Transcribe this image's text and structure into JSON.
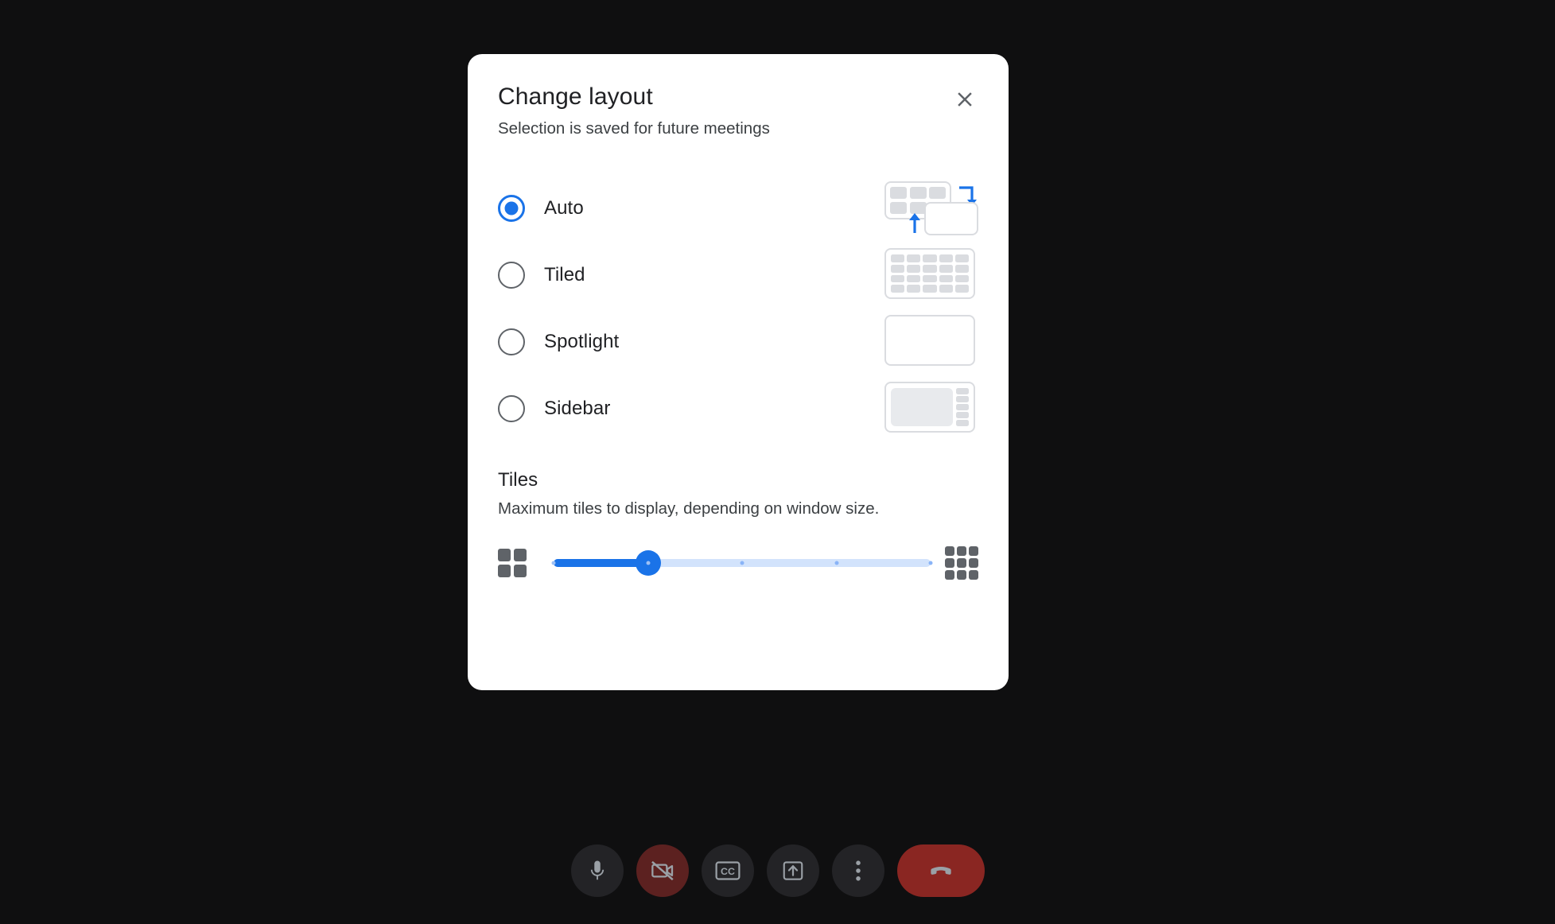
{
  "background_color": "#0f0f10",
  "dialog": {
    "title": "Change layout",
    "subtitle": "Selection is saved for future meetings",
    "close_label": "Close",
    "close_icon": "close-icon",
    "accent_color": "#1a73e8",
    "options": [
      {
        "id": "auto",
        "label": "Auto",
        "selected": true,
        "preview": "auto-preview-grid-and-pip"
      },
      {
        "id": "tiled",
        "label": "Tiled",
        "selected": false,
        "preview": "tiled-preview-5x4-grid"
      },
      {
        "id": "spotlight",
        "label": "Spotlight",
        "selected": false,
        "preview": "spotlight-preview-single-tile"
      },
      {
        "id": "sidebar",
        "label": "Sidebar",
        "selected": false,
        "preview": "sidebar-preview-main-plus-rail"
      }
    ],
    "tiles": {
      "title": "Tiles",
      "description": "Maximum tiles to display, depending on window size.",
      "min_icon": "grid-2x2-icon",
      "max_icon": "grid-3x3-icon",
      "value": 2,
      "min": 1,
      "max": 5,
      "tick_count": 5
    }
  },
  "toolbar": {
    "buttons": [
      {
        "id": "microphone",
        "icon": "microphone-icon",
        "label": "Turn off microphone",
        "state": "on",
        "style": "default"
      },
      {
        "id": "camera",
        "icon": "camera-off-icon",
        "label": "Turn on camera",
        "state": "off",
        "style": "danger"
      },
      {
        "id": "captions",
        "icon": "closed-caption-icon",
        "label": "Turn on captions",
        "state": "off",
        "style": "default"
      },
      {
        "id": "present",
        "icon": "present-screen-icon",
        "label": "Present now",
        "state": "off",
        "style": "default"
      },
      {
        "id": "more",
        "icon": "more-vertical-icon",
        "label": "More options",
        "state": "off",
        "style": "default"
      },
      {
        "id": "leave-call",
        "icon": "call-end-icon",
        "label": "Leave call",
        "state": "off",
        "style": "end-call"
      }
    ]
  }
}
